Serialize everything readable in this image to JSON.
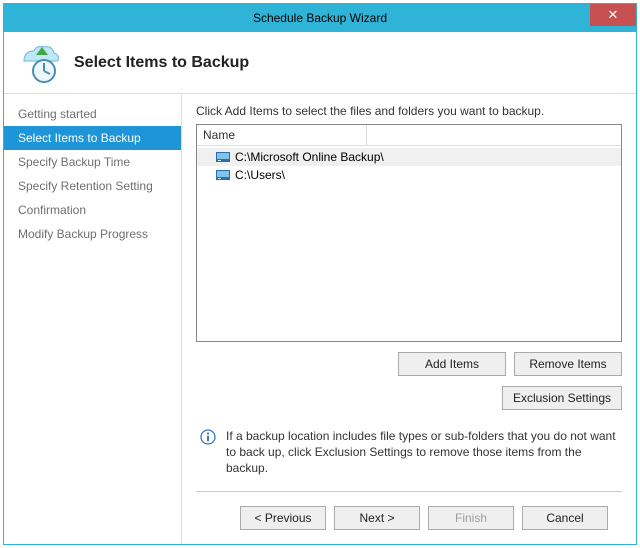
{
  "window": {
    "title": "Schedule Backup Wizard"
  },
  "header": {
    "page_title": "Select Items to Backup"
  },
  "sidebar": {
    "items": [
      {
        "label": "Getting started",
        "active": false
      },
      {
        "label": "Select Items to Backup",
        "active": true
      },
      {
        "label": "Specify Backup Time",
        "active": false
      },
      {
        "label": "Specify Retention Setting",
        "active": false
      },
      {
        "label": "Confirmation",
        "active": false
      },
      {
        "label": "Modify Backup Progress",
        "active": false
      }
    ]
  },
  "main": {
    "instruction": "Click Add Items to select the files and folders you want to backup.",
    "list": {
      "header": "Name",
      "rows": [
        {
          "path": "C:\\Microsoft Online Backup\\",
          "selected": true
        },
        {
          "path": "C:\\Users\\",
          "selected": false
        }
      ]
    },
    "buttons": {
      "add": "Add Items",
      "remove": "Remove Items",
      "exclusion": "Exclusion Settings"
    },
    "info_text": "If a backup location includes file types or sub-folders that you do not want to back up, click Exclusion Settings to remove those items from the backup."
  },
  "footer": {
    "previous": "< Previous",
    "next": "Next >",
    "finish": "Finish",
    "cancel": "Cancel"
  }
}
